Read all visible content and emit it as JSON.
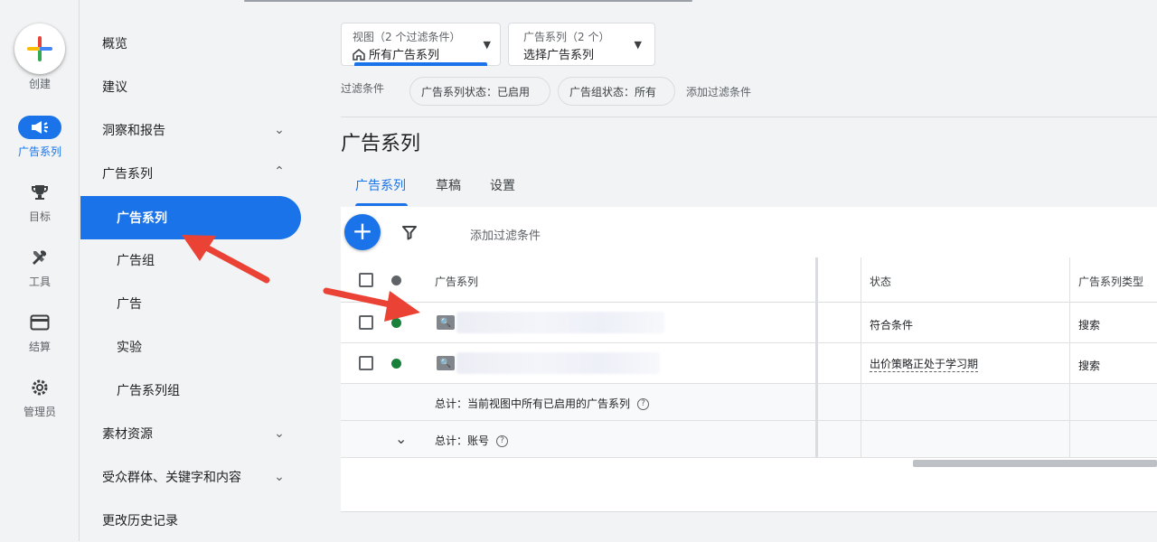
{
  "rail": {
    "create": "创建",
    "items": [
      {
        "label": "广告系列",
        "icon": "megaphone-icon"
      },
      {
        "label": "目标",
        "icon": "trophy-icon"
      },
      {
        "label": "工具",
        "icon": "tools-icon"
      },
      {
        "label": "结算",
        "icon": "credit-card-icon"
      },
      {
        "label": "管理员",
        "icon": "gear-icon"
      }
    ]
  },
  "nav": {
    "items": [
      {
        "label": "概览"
      },
      {
        "label": "建议"
      },
      {
        "label": "洞察和报告"
      },
      {
        "label": "广告系列"
      },
      {
        "label": "广告系列"
      },
      {
        "label": "广告组"
      },
      {
        "label": "广告"
      },
      {
        "label": "实验"
      },
      {
        "label": "广告系列组"
      },
      {
        "label": "素材资源"
      },
      {
        "label": "受众群体、关键字和内容"
      },
      {
        "label": "更改历史记录"
      }
    ]
  },
  "view_picker": {
    "small": "视图（2 个过滤条件）",
    "big": "所有广告系列"
  },
  "campaign_picker": {
    "small": "广告系列（2 个）",
    "big": "选择广告系列"
  },
  "filters": {
    "label": "过滤条件",
    "chips": [
      "广告系列状态：已启用",
      "广告组状态：所有"
    ],
    "add": "添加过滤条件"
  },
  "page_title": "广告系列",
  "tabs": [
    "广告系列",
    "草稿",
    "设置"
  ],
  "toolbar": {
    "add_filter": "添加过滤条件"
  },
  "table": {
    "headers": {
      "campaign": "广告系列",
      "status": "状态",
      "type": "广告系列类型"
    },
    "rows": [
      {
        "status": "符合条件",
        "type": "搜索"
      },
      {
        "status": "出价策略正处于学习期",
        "type": "搜索"
      }
    ],
    "total_view": "总计：当前视图中所有已启用的广告系列",
    "total_account": "总计：账号"
  },
  "colors": {
    "accent": "#1a73e8",
    "enabled": "#188038",
    "arrow": "#ea4335"
  }
}
